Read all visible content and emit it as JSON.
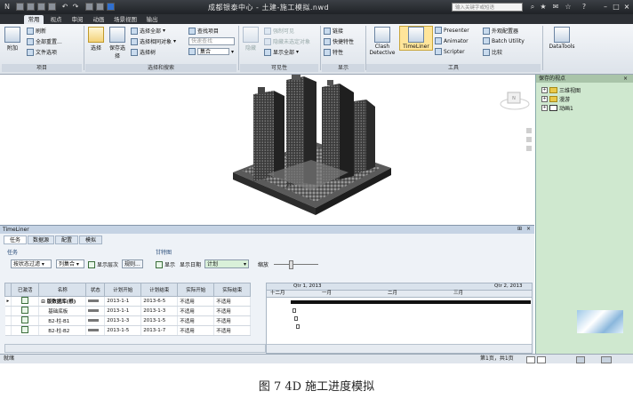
{
  "app": {
    "window_title": "成都银泰中心 - 土建-施工模拟.nwd",
    "search_placeholder": "输入关键字或短语"
  },
  "ribbon": {
    "tabs": [
      "常用",
      "视点",
      "审阅",
      "动画",
      "场景视图",
      "输出"
    ],
    "active_tab": "常用",
    "project": {
      "append": "附加",
      "refresh": "刷新",
      "reset_all": "全部重置...",
      "file_options": "文件选项",
      "label": "项目"
    },
    "select": {
      "select_btn": "选择",
      "save_select": "保存选择",
      "select_all": "选择全部",
      "select_same": "选择相同对象",
      "select_tree": "选择树",
      "find_items": "查找项目",
      "quick_find_placeholder": "快速查找",
      "sets": "集合",
      "label": "选择和搜索"
    },
    "visibility": {
      "hide": "隐藏",
      "require": "强制可见",
      "hide_unselected": "隐藏未选定对象",
      "unhide_all": "显示全部",
      "label": "可见性"
    },
    "display": {
      "links": "链接",
      "quick_props": "快捷特性",
      "properties": "特性",
      "label": "显示"
    },
    "tools": {
      "clash": "Clash Detective",
      "timeliner": "TimeLiner",
      "presenter": "Presenter",
      "animator": "Animator",
      "scripter": "Scripter",
      "appearance": "外观配置器",
      "batch": "Batch Utility",
      "compare": "比较",
      "label": "工具"
    },
    "datatools": "DataTools"
  },
  "saved_viewpoints": {
    "title": "保存的视点",
    "items": [
      "三维视图",
      "漫游",
      "动画1"
    ]
  },
  "timeliner": {
    "title": "TimeLiner",
    "tabs": [
      "任务",
      "数据源",
      "配置",
      "模拟"
    ],
    "active_tab": "任务",
    "toolbar": {
      "tasks_label": "任务",
      "filter": "按状态过滤",
      "columns": "列集合",
      "show_hierarchy": "显示层次",
      "rules": "规则..."
    },
    "gantt_controls": {
      "label": "甘特图",
      "show": "显示",
      "show_date_label": "显示日期",
      "show_date_value": "计划",
      "zoom_label": "缩放"
    },
    "columns": [
      "已激活",
      "名称",
      "状态",
      "计划开始",
      "计划结束",
      "实际开始",
      "实际结束"
    ],
    "rows": [
      {
        "name": "版数据库(根)",
        "start": "2013-1-1",
        "end": "2013-6-5",
        "actual_start": "不适用",
        "actual_end": "不适用"
      },
      {
        "name": "基础底板",
        "start": "2013-1-1",
        "end": "2013-1-3",
        "actual_start": "不适用",
        "actual_end": "不适用"
      },
      {
        "name": "B2-柱-B1",
        "start": "2013-1-3",
        "end": "2013-1-5",
        "actual_start": "不适用",
        "actual_end": "不适用"
      },
      {
        "name": "B2-柱-B2",
        "start": "2013-1-5",
        "end": "2013-1-7",
        "actual_start": "不适用",
        "actual_end": "不适用"
      }
    ],
    "gantt": {
      "quarter1": "Qtr 1, 2013",
      "quarter2": "Qtr 2, 2013",
      "months": [
        "十二月",
        "一月",
        "二月",
        "三月"
      ]
    }
  },
  "statusbar": {
    "left": "就绪",
    "right": "第1页，共1页"
  },
  "caption": "图 7    4D 施工进度模拟"
}
